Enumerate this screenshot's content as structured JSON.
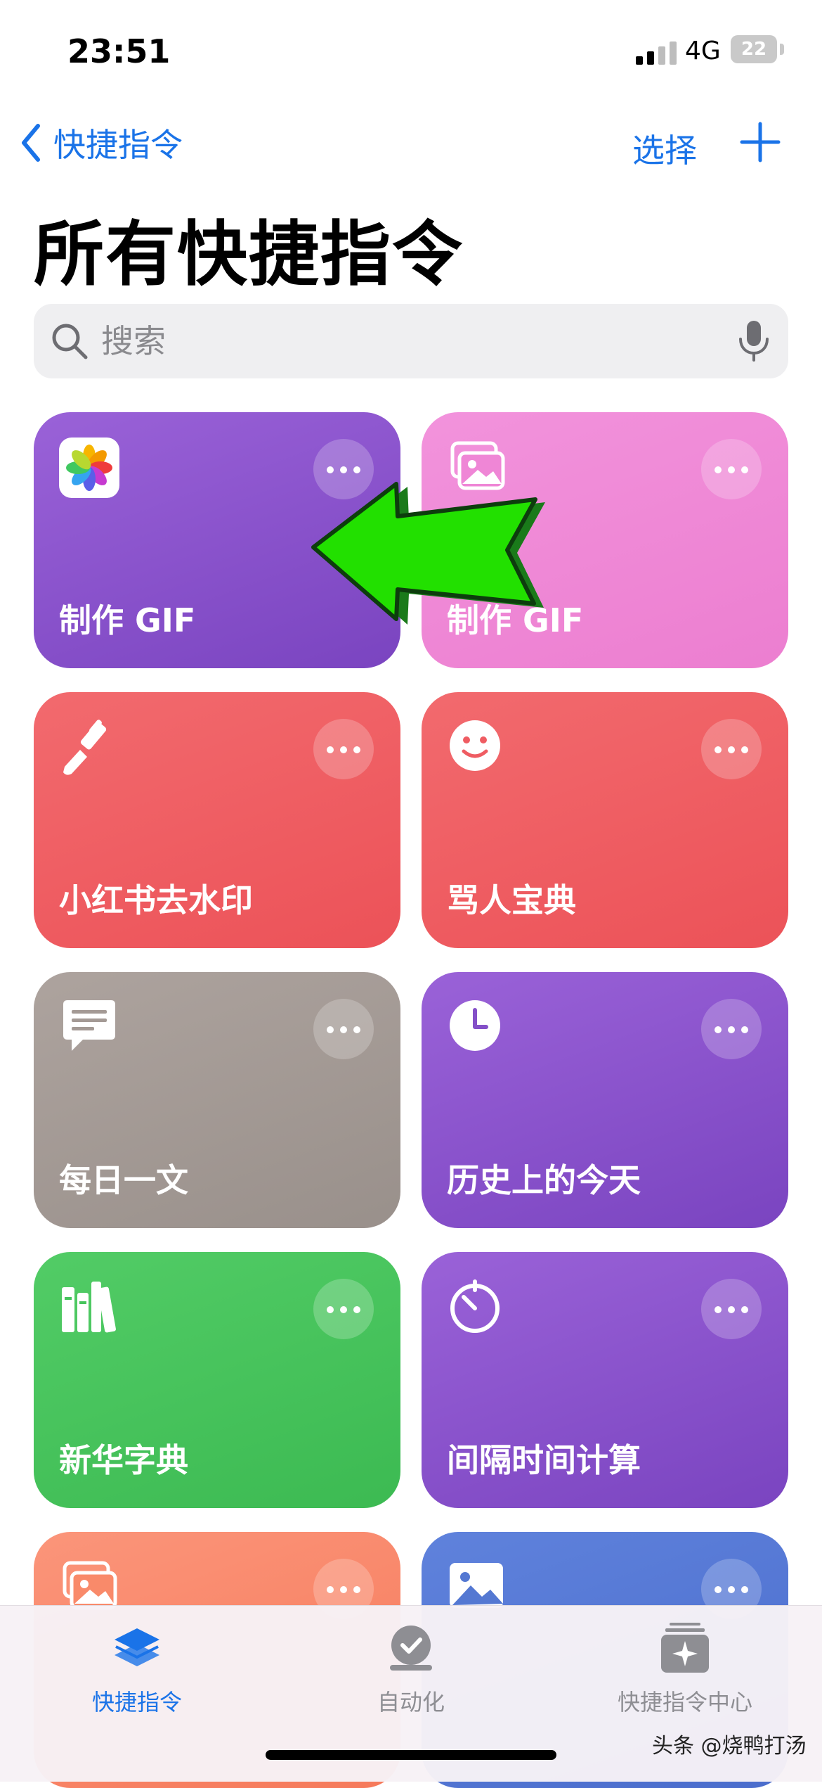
{
  "status_bar": {
    "time": "23:51",
    "network": "4G",
    "battery": "22"
  },
  "nav": {
    "back_label": "快捷指令",
    "select_label": "选择"
  },
  "page_title": "所有快捷指令",
  "search": {
    "placeholder": "搜索"
  },
  "shortcuts": [
    {
      "label": "制作 GIF",
      "icon": "photos-app-icon",
      "color": "#8450c8"
    },
    {
      "label": "制作 GIF",
      "icon": "photos-stack-icon",
      "color": "#ef86d6"
    },
    {
      "label": "小红书去水印",
      "icon": "paintbrush-icon",
      "color": "#ef5c62"
    },
    {
      "label": "骂人宝典",
      "icon": "smiley-icon",
      "color": "#ef5c62"
    },
    {
      "label": "每日一文",
      "icon": "message-icon",
      "color": "#a49a95"
    },
    {
      "label": "历史上的今天",
      "icon": "clock-icon",
      "color": "#8450c8"
    },
    {
      "label": "新华字典",
      "icon": "books-icon",
      "color": "#46c45c"
    },
    {
      "label": "间隔时间计算",
      "icon": "timer-icon",
      "color": "#8450c8"
    },
    {
      "label": "",
      "icon": "photos-stack-icon",
      "color": "#f98a6a"
    },
    {
      "label": "",
      "icon": "photo-icon",
      "color": "#5478d2"
    }
  ],
  "tabbar": {
    "tabs": [
      {
        "label": "快捷指令",
        "icon": "layers-icon",
        "active": true
      },
      {
        "label": "自动化",
        "icon": "automation-clock-icon",
        "active": false
      },
      {
        "label": "快捷指令中心",
        "icon": "gallery-sparkle-icon",
        "active": false
      }
    ]
  },
  "watermark": "头条 @烧鸭打汤"
}
